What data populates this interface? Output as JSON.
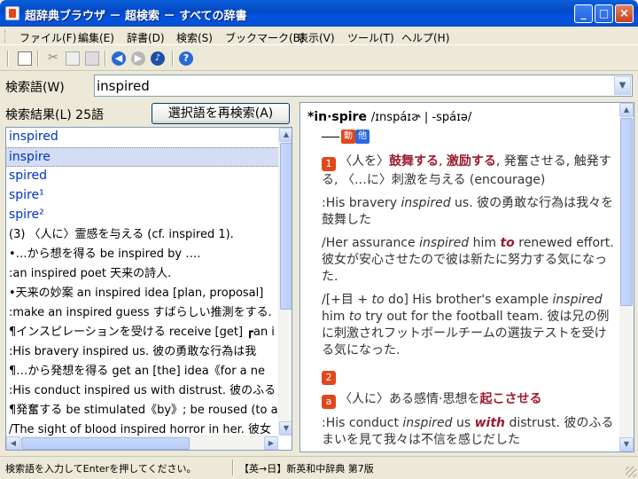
{
  "window": {
    "title": "超辞典ブラウザ － 超検索 － すべての辞書",
    "min_glyph": "_",
    "max_glyph": "□",
    "close_glyph": "×"
  },
  "menu": [
    "ファイル(F)",
    "編集(E)",
    "辞書(D)",
    "検索(S)",
    "ブックマーク(B)",
    "表示(V)",
    "ツール(T)",
    "ヘルプ(H)"
  ],
  "toolbar": {
    "icons": [
      "new-document-icon",
      "cut-icon",
      "copy-icon",
      "paste-icon",
      "back-icon",
      "forward-icon",
      "speaker-icon",
      "help-icon"
    ],
    "back_glyph": "◀",
    "forward_glyph": "▶",
    "sound_glyph": "♪",
    "help_glyph": "?"
  },
  "search": {
    "label": "検索語(W)",
    "value": "inspired",
    "dropdown_glyph": "▼"
  },
  "results": {
    "label": "検索結果(L) 25語",
    "research_button": "選択語を再検索(A)",
    "items": [
      "inspired",
      "inspire",
      "spired",
      "spire¹",
      "spire²",
      "(3) 〈人に〉霊感を与える (cf. inspired 1).",
      "•…から想を得る be inspired by ….",
      ":an inspired poet 天来の詩人.",
      "•天来の妙案 an inspired idea [plan, proposal]",
      ":make an inspired guess すばらしい推測をする.",
      "¶インスピレーションを受ける receive [get] ┏an i",
      ":His bravery inspired us. 彼の勇敢な行為は我",
      "¶…から発想を得る get an [the] idea《for a ne",
      ":His conduct inspired us with distrust. 彼のふる",
      "¶発奮する be stimulated《by》; be roused (to a",
      "/The sight of blood inspired horror in her. 彼女"
    ],
    "selected_index": 1,
    "scroll_up": "▲",
    "scroll_down": "▼",
    "scroll_left": "◀",
    "scroll_right": "▶"
  },
  "entry": {
    "headword": "*in·spire",
    "pronunciation": "/ɪnspáɪɚ | -spáɪə/",
    "pos_verb": "動",
    "pos_other": "他",
    "sense1": {
      "num": "1",
      "pre": "〈人を〉",
      "kw1": "鼓舞する",
      "sep1": ", ",
      "kw2": "激励する",
      "rest": ", 発奮させる, 触発する, 〈…に〉刺激を与える (encourage)"
    },
    "examples": [
      {
        "p1": ":His bravery ",
        "i1": "inspired",
        "p2": " us. 彼の勇敢な行為は我々を鼓舞した"
      },
      {
        "p1": "/Her assurance ",
        "i1": "inspired",
        "p2": " him ",
        "b1": "to",
        "p3": " renewed effort. 彼女が安心させたので彼は新たに努力する気になった."
      },
      {
        "p1": "/[+目 + ",
        "i1": "to",
        "p2": " do] His brother's example ",
        "i2": "inspired",
        "p3": " him ",
        "i3": "to",
        "p4": " try out for the football team. 彼は兄の例に刺激されフットボールチームの選抜テストを受ける気になった."
      }
    ],
    "sense2": {
      "num": "2",
      "sub": "a",
      "pre": "〈人に〉ある感情·思想を",
      "kw": "起こさせる"
    },
    "example4": {
      "p1": ":His conduct ",
      "i1": "inspired",
      "p2": " us ",
      "b1": "with",
      "p3": " distrust. 彼のふるまいを見て我々は不信を感じだした"
    }
  },
  "status": {
    "left": "検索語を入力してEnterを押してください。",
    "right": "【英→日】新英和中辞典 第7版"
  }
}
